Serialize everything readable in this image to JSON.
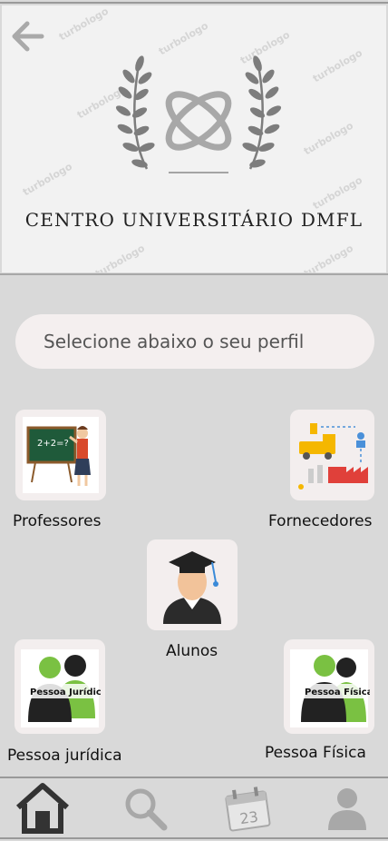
{
  "header": {
    "brand_name": "CENTRO UNIVERSITÁRIO DMFL",
    "watermark_text": "turbologo",
    "back_icon": "arrow-left-icon"
  },
  "search": {
    "placeholder": "Selecione abaixo o seu perfil"
  },
  "profiles": [
    {
      "label": "Professores",
      "icon": "teacher-icon"
    },
    {
      "label": "Fornecedores",
      "icon": "supplier-icon"
    },
    {
      "label": "Alunos",
      "icon": "graduate-student-icon"
    },
    {
      "label": "Pessoa jurídica",
      "icon": "legal-entity-icon",
      "badge": "Pessoa Jurídica"
    },
    {
      "label": "Pessoa Física",
      "icon": "natural-person-icon",
      "badge": "Pessoa Física"
    }
  ],
  "tabbar": {
    "items": [
      {
        "icon": "home-icon",
        "active": true
      },
      {
        "icon": "search-icon",
        "active": false
      },
      {
        "icon": "calendar-icon",
        "active": false,
        "day": "23"
      },
      {
        "icon": "user-icon",
        "active": false
      }
    ]
  },
  "colors": {
    "background": "#d9d9d9",
    "card": "#f3eeee",
    "active_tab": "#333333",
    "inactive_tab": "#a8a8a8"
  }
}
